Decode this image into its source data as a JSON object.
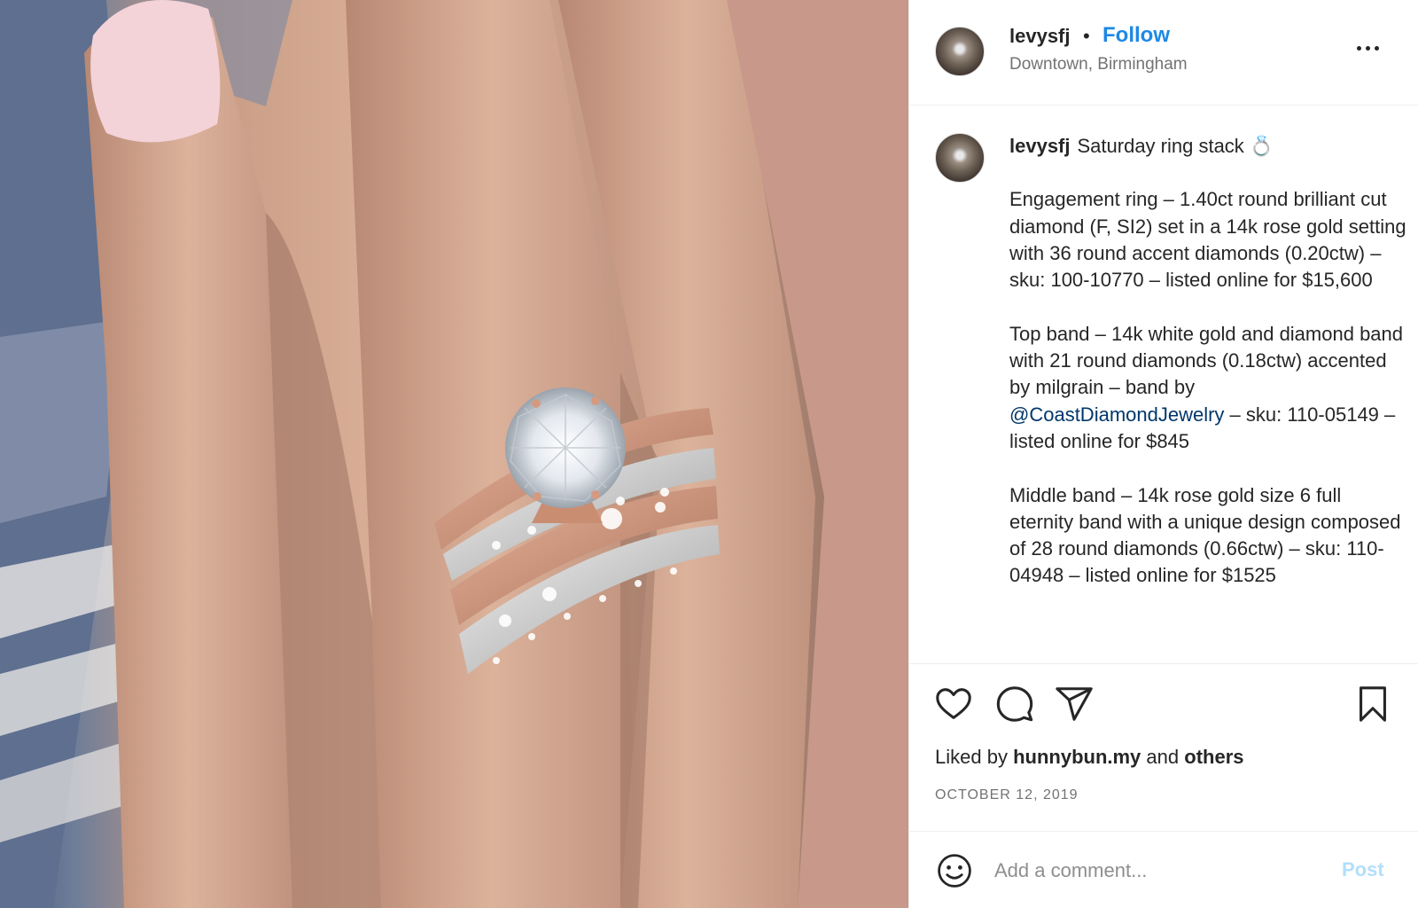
{
  "header": {
    "username": "levysfj",
    "separator": "•",
    "follow_label": "Follow",
    "location": "Downtown, Birmingham",
    "more_icon": "more-horizontal-icon"
  },
  "caption": {
    "username": "levysfj",
    "first_line": "Saturday ring stack 💍",
    "paragraphs": [
      "Engagement ring – 1.40ct round brilliant cut diamond (F, SI2) set in a 14k rose gold setting with 36 round accent diamonds (0.20ctw) – sku: 100-10770 – listed online for $15,600",
      "Middle band – 14k rose gold size 6 full eternity band with a unique design composed of 28 round diamonds (0.66ctw) – sku: 110-04948 – listed online for $1525"
    ],
    "top_band": {
      "before": "Top band – 14k white gold and diamond band with 21 round diamonds (0.18ctw) accented by milgrain – band by ",
      "mention": "@CoastDiamondJewelry",
      "after": " – sku: 110-05149 – listed online for $845"
    }
  },
  "actions": {
    "icons": [
      "heart-icon",
      "comment-icon",
      "share-icon",
      "bookmark-icon"
    ],
    "liked_prefix": "Liked by",
    "liked_user": "hunnybun.my",
    "liked_and": "and",
    "liked_others": "others",
    "date": "OCTOBER 12, 2019"
  },
  "comment": {
    "placeholder": "Add a comment...",
    "post_label": "Post",
    "emoji_icon": "smiley-icon"
  },
  "colors": {
    "link_blue": "#1e88e5",
    "mention_blue": "#00376b",
    "post_disabled": "#b2dffc",
    "muted_text": "#737373",
    "border": "#efefef"
  }
}
